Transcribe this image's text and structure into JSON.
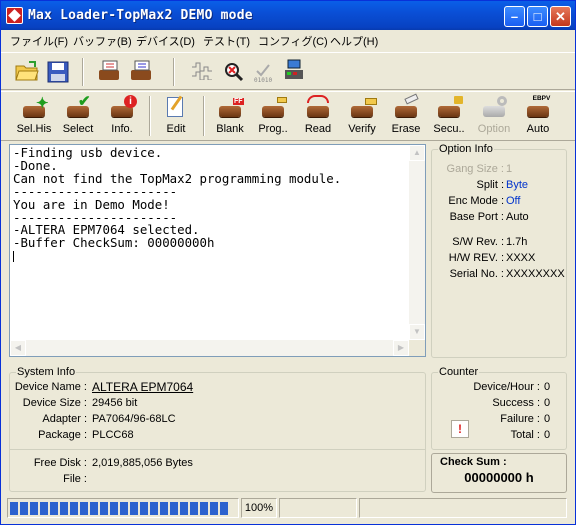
{
  "window": {
    "title": "Max Loader-TopMax2 DEMO mode"
  },
  "menu": [
    "ファイル(F)",
    "バッファ(B)",
    "デバイス(D)",
    "テスト(T)",
    "コンフィグ(C)",
    "ヘルプ(H)"
  ],
  "toolbar2": {
    "sel_his": "Sel.His",
    "select": "Select",
    "info": "Info.",
    "edit": "Edit",
    "blank": "Blank",
    "prog": "Prog..",
    "read": "Read",
    "verify": "Verify",
    "erase": "Erase",
    "secu": "Secu..",
    "option": "Option",
    "auto": "Auto",
    "blank_badge": "FF",
    "auto_badge": "EBPV"
  },
  "log": {
    "text": "-Finding usb device.\n-Done.\nCan not find the TopMax2 programming module.\n----------------------\nYou are in Demo Mode!\n----------------------\n-ALTERA EPM7064 selected.\n-Buffer CheckSum: 00000000h\n"
  },
  "option_info": {
    "title": "Option Info",
    "gang_size_label": "Gang Size :",
    "gang_size_value": "1",
    "split_label": "Split :",
    "split_value": "Byte",
    "enc_mode_label": "Enc Mode :",
    "enc_mode_value": "Off",
    "base_port_label": "Base Port :",
    "base_port_value": "Auto",
    "sw_rev_label": "S/W Rev. :",
    "sw_rev_value": "1.7h",
    "hw_rev_label": "H/W REV. :",
    "hw_rev_value": "XXXX",
    "serial_label": "Serial No. :",
    "serial_value": "XXXXXXXX"
  },
  "system_info": {
    "title": "System Info",
    "device_name_label": "Device Name :",
    "device_name_value": "ALTERA EPM7064",
    "device_size_label": "Device Size :",
    "device_size_value": "29456 bit",
    "adapter_label": "Adapter :",
    "adapter_value": "PA7064/96-68LC",
    "package_label": "Package :",
    "package_value": "PLCC68",
    "free_disk_label": "Free Disk :",
    "free_disk_value": "2,019,885,056 Bytes",
    "file_label": "File :",
    "file_value": ""
  },
  "counter": {
    "title": "Counter",
    "device_hour_label": "Device/Hour :",
    "device_hour_value": "0",
    "success_label": "Success :",
    "success_value": "0",
    "failure_label": "Failure :",
    "failure_value": "0",
    "total_label": "Total :",
    "total_value": "0",
    "reset_glyph": "!"
  },
  "checksum": {
    "title": "Check Sum :",
    "value": "00000000 h"
  },
  "status": {
    "progress_text": "100%",
    "progress_fraction": 1.0
  },
  "colors": {
    "titlebar": "#0a4fd6",
    "accent_blue": "#0033cc",
    "progress": "#2c62ce",
    "face": "#ece9d8"
  }
}
